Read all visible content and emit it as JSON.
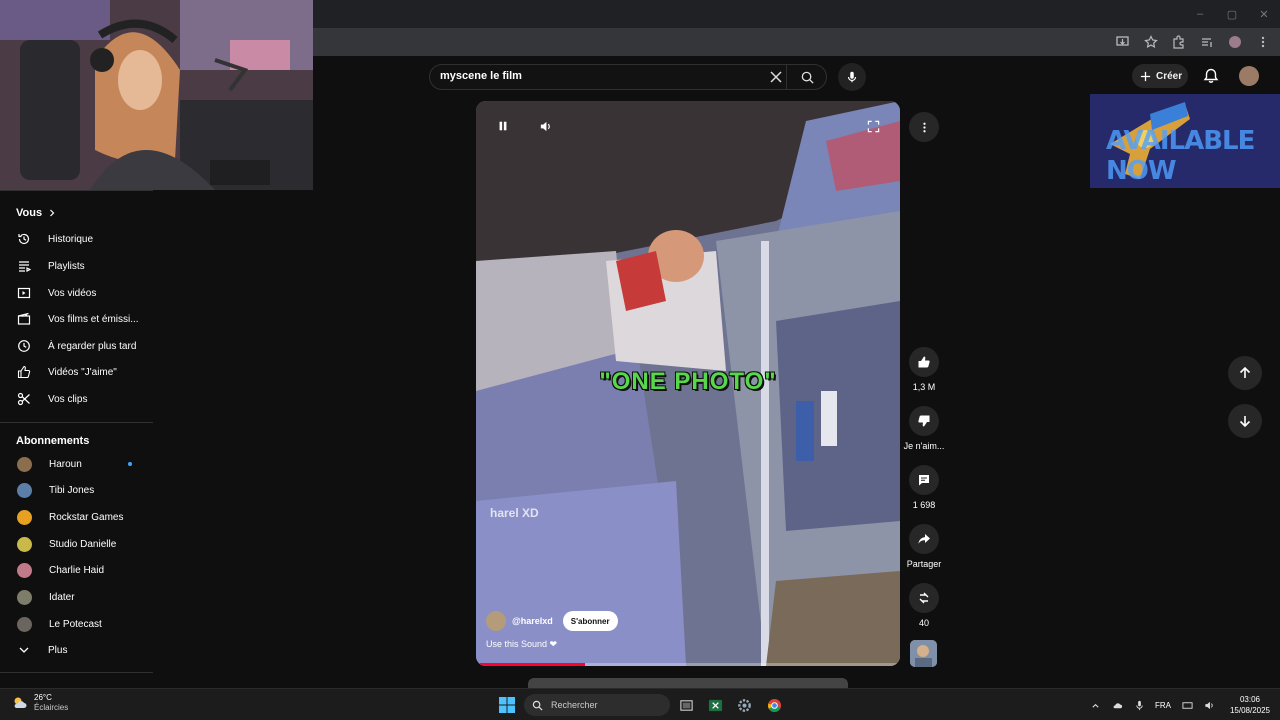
{
  "browser": {
    "window_controls": {
      "minimize": "–",
      "maximize": "▢",
      "close": "✕"
    }
  },
  "search": {
    "query": "myscene le film"
  },
  "header": {
    "create_label": "Créer"
  },
  "sidebar": {
    "you_title": "Vous",
    "you_items": [
      {
        "label": "Historique",
        "icon": "history-icon"
      },
      {
        "label": "Playlists",
        "icon": "playlists-icon"
      },
      {
        "label": "Vos vidéos",
        "icon": "your-videos-icon"
      },
      {
        "label": "Vos films et émissi...",
        "icon": "movies-icon"
      },
      {
        "label": "À regarder plus tard",
        "icon": "watch-later-icon"
      },
      {
        "label": "Vidéos \"J'aime\"",
        "icon": "liked-videos-icon"
      },
      {
        "label": "Vos clips",
        "icon": "clips-icon"
      }
    ],
    "subs_title": "Abonnements",
    "subscriptions": [
      {
        "label": "Haroun",
        "color": "#8b6e4e",
        "live": true
      },
      {
        "label": "Tibi Jones",
        "color": "#5c7fa8",
        "live": false
      },
      {
        "label": "Rockstar Games",
        "color": "#e8a021",
        "live": false
      },
      {
        "label": "Studio Danielle",
        "color": "#c9b84a",
        "live": false
      },
      {
        "label": "Charlie Haid",
        "color": "#c07a8a",
        "live": false
      },
      {
        "label": "Idater",
        "color": "#7d7d6a",
        "live": false
      },
      {
        "label": "Le Potecast",
        "color": "#6b6560",
        "live": false
      }
    ],
    "more_label": "Plus"
  },
  "video": {
    "caption": "\"ONE PHOTO\"",
    "watermark": "harel XD",
    "channel": "@harelxd",
    "subscribe_label": "S'abonner",
    "sound": "Use this Sound ❤",
    "progress": 0.25
  },
  "actions": {
    "likes": "1,3 M",
    "dislike_label": "Je n'aim...",
    "comments": "1 698",
    "share_label": "Partager",
    "remix_count": "40"
  },
  "ad": {
    "text": "AVAILABLE NOW"
  },
  "taskbar": {
    "temperature": "26°C",
    "weather": "Éclaircies",
    "search_placeholder": "Rechercher",
    "language": "FRA",
    "time": "03:06",
    "date": "15/08/2025"
  }
}
